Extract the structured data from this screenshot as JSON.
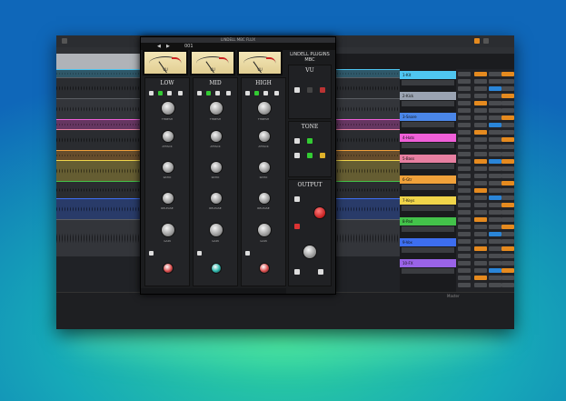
{
  "plugin": {
    "window_title": "LINDELL MBC FLUX",
    "brand_line1": "LINDELL PLUGINS",
    "brand_line2": "MBC",
    "preset_index": "001",
    "bands": [
      {
        "name": "LOW",
        "knob_labels": [
          "THRESH",
          "ATTACK",
          "RATIO",
          "RELEASE",
          "GAIN"
        ]
      },
      {
        "name": "MID",
        "knob_labels": [
          "THRESH",
          "ATTACK",
          "RATIO",
          "RELEASE",
          "GAIN"
        ]
      },
      {
        "name": "HIGH",
        "knob_labels": [
          "THRESH",
          "ATTACK",
          "RATIO",
          "RELEASE",
          "GAIN"
        ]
      }
    ],
    "sections": {
      "vu": "VU",
      "tone": "TONE",
      "output": "OUTPUT"
    },
    "meter_label": "VU"
  },
  "tracks": [
    {
      "name": "1-Kit",
      "color": "#4fc6f0"
    },
    {
      "name": "2-Kick",
      "color": "#9aa3b2"
    },
    {
      "name": "3-Snare",
      "color": "#4a86e8"
    },
    {
      "name": "4-Hats",
      "color": "#f05fd8"
    },
    {
      "name": "5-Bass",
      "color": "#e77fa1"
    },
    {
      "name": "6-Gtr",
      "color": "#f0a13a"
    },
    {
      "name": "7-Keys",
      "color": "#f0d54a"
    },
    {
      "name": "8-Pad",
      "color": "#43c24a"
    },
    {
      "name": "9-Vox",
      "color": "#3d6ef0"
    },
    {
      "name": "10-FX",
      "color": "#9a63e8"
    }
  ],
  "colors": {
    "accent": "#e58a1f",
    "blue": "#2a85d8"
  },
  "master_label": "Master"
}
